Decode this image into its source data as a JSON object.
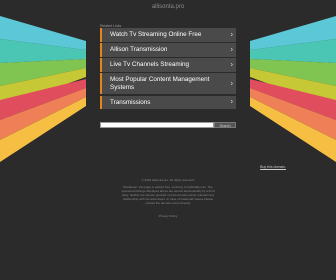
{
  "header": {
    "domain": "allisonta.pro"
  },
  "related": {
    "label": "Related Links",
    "items": [
      {
        "label": "Watch Tv Streaming Online Free"
      },
      {
        "label": "Allison Transmission"
      },
      {
        "label": "Live Tv Channels Streaming"
      },
      {
        "label": "Most Popular Content Management Systems"
      },
      {
        "label": "Transmissions"
      }
    ]
  },
  "search": {
    "placeholder": "",
    "button_label": "Search"
  },
  "sale": {
    "label": "Buy this domain."
  },
  "footer": {
    "copyright": "© 2022 allisonta.pro. All rights reserved.",
    "disclaimer_lines": [
      "Disclaimer: this page is parked free, courtesy of GoDaddy.com. The",
      "sponsored listings displayed above are served automatically by a third",
      "party. Neither the service provider nor the domain owner maintain any",
      "relationship with the advertisers. In case of trademark issues please",
      "contact the domain owner directly."
    ],
    "privacy": "Privacy Policy"
  },
  "colors": {
    "background": "#2b2b2b",
    "item_background": "#4a4a4a",
    "item_accent": "#e6851c",
    "stripe_colors": [
      "#5cc7d6",
      "#4cc6b4",
      "#80c452",
      "#c7c836",
      "#e04d5c",
      "#ee7f56",
      "#f6bf43"
    ]
  }
}
